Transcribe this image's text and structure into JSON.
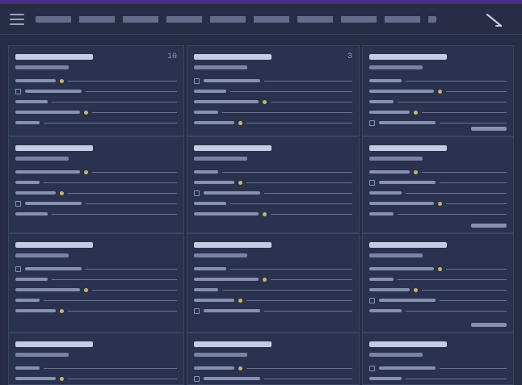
{
  "colors": {
    "accent": "#4b2d8c",
    "background": "#262d45",
    "panel": "#2a3250",
    "highlight": "#c9b46a"
  },
  "header": {
    "menu_icon": "hamburger-icon",
    "action_icon": "edit-icon"
  },
  "panels": [
    {
      "count": "10"
    },
    {
      "count": "3"
    },
    {
      "count": ""
    },
    {
      "count": ""
    },
    {
      "count": ""
    },
    {
      "count": ""
    },
    {
      "count": ""
    },
    {
      "count": ""
    },
    {
      "count": ""
    },
    {
      "count": ""
    },
    {
      "count": ""
    },
    {
      "count": ""
    }
  ]
}
